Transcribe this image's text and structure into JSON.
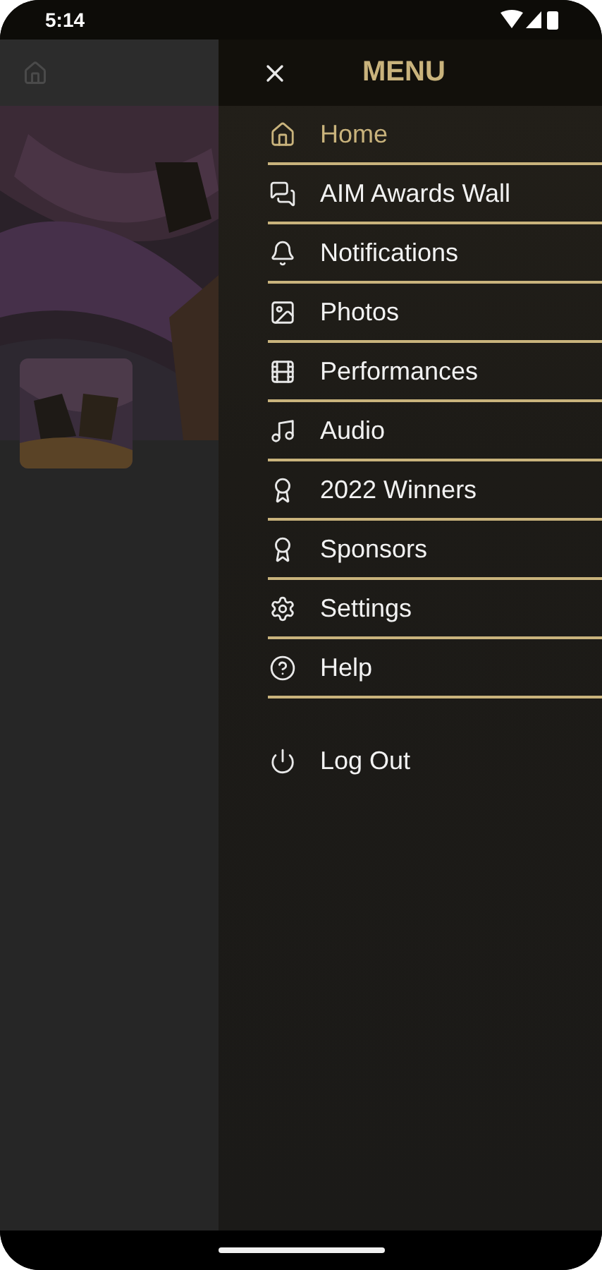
{
  "status_bar": {
    "time": "5:14"
  },
  "background": {
    "header": {
      "kind": "home"
    }
  },
  "drawer": {
    "title": "MENU",
    "items": [
      {
        "label": "Home",
        "kind": "home",
        "selected": true
      },
      {
        "label": "AIM Awards Wall",
        "kind": "chat",
        "selected": false
      },
      {
        "label": "Notifications",
        "kind": "bell",
        "selected": false
      },
      {
        "label": "Photos",
        "selected": false
      },
      {
        "label": "Performances",
        "kind": "film",
        "selected": false
      },
      {
        "label": "Audio",
        "kind": "music",
        "selected": false
      },
      {
        "label": "2022 Winners",
        "kind": "award",
        "selected": false
      },
      {
        "label": "Sponsors",
        "kind": "sponsor",
        "selected": false
      },
      {
        "label": "Settings",
        "kind": "gear",
        "selected": false
      },
      {
        "label": "Help",
        "kind": "help",
        "selected": false
      }
    ],
    "footer_item": {
      "label": "Log Out",
      "kind": "power"
    }
  }
}
